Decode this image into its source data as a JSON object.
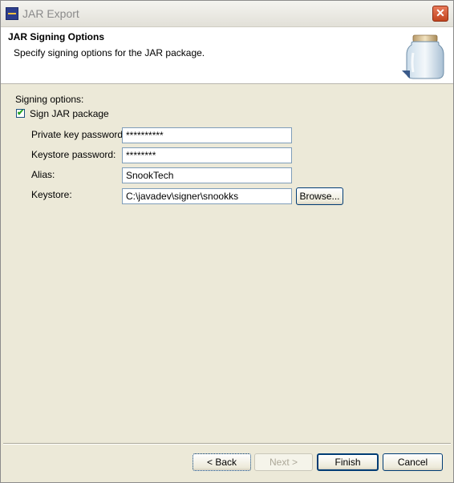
{
  "window": {
    "title": "JAR Export",
    "close_label": "✕"
  },
  "banner": {
    "title": "JAR Signing Options",
    "description": "Specify signing options for the JAR package."
  },
  "form": {
    "section_label": "Signing options:",
    "sign_checkbox": {
      "label": "Sign JAR package",
      "checked": true,
      "mark": "✔"
    },
    "private_key_password": {
      "label": "Private key password:",
      "value": "**********"
    },
    "keystore_password": {
      "label": "Keystore password:",
      "value": "********"
    },
    "alias": {
      "label": "Alias:",
      "value": "SnookTech"
    },
    "keystore": {
      "label": "Keystore:",
      "value": "C:\\javadev\\signer\\snookks",
      "browse_label": "Browse..."
    }
  },
  "buttons": {
    "back": "< Back",
    "next": "Next >",
    "finish": "Finish",
    "cancel": "Cancel"
  },
  "icons": {
    "app": "eclipse-app-icon",
    "banner": "jar-icon",
    "close": "close-icon"
  }
}
